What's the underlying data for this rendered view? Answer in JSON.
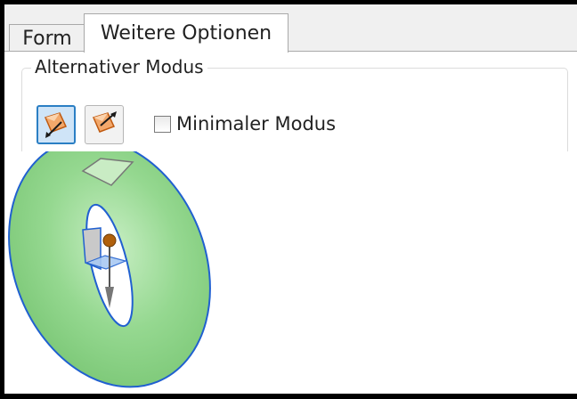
{
  "tabs": [
    {
      "label": "Form",
      "active": false
    },
    {
      "label": "Weitere Optionen",
      "active": true
    }
  ],
  "group": {
    "title": "Alternativer Modus",
    "mode_buttons": [
      {
        "icon": "flip-normal-icon",
        "selected": true
      },
      {
        "icon": "flip-reverse-icon",
        "selected": false
      }
    ],
    "checkbox": {
      "label": "Minimaler Modus",
      "checked": false
    }
  },
  "viewport": {
    "model": "torus-cut-icon",
    "colors": {
      "face": "#8fd48a",
      "edge": "#2060d0",
      "hole": "#ffffff",
      "axis_dot": "#b0600c"
    }
  },
  "colors": {
    "accent": "#2b7fc4",
    "panel": "#f0f0f0",
    "border": "#a9a9a9"
  }
}
